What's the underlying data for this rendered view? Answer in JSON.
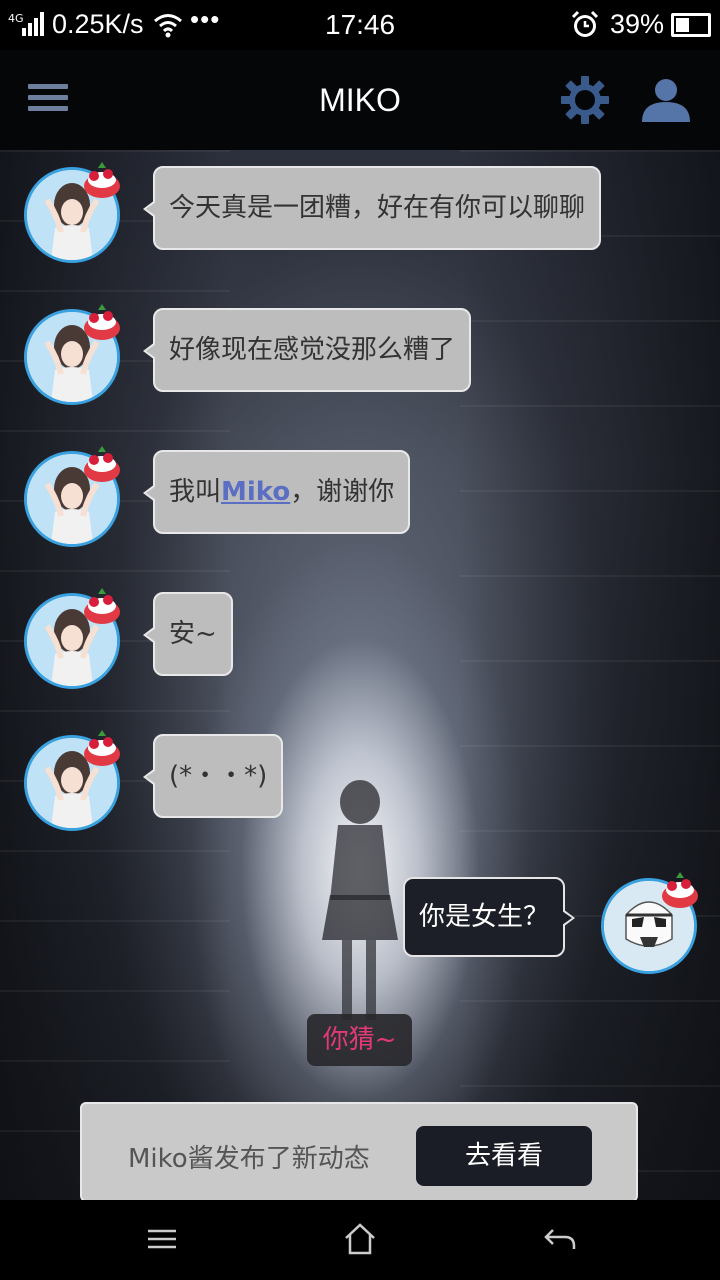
{
  "status_bar": {
    "network": "4G",
    "speed": "0.25K/s",
    "more": "•••",
    "time": "17:46",
    "battery_pct": "39%",
    "battery_level": 0.39
  },
  "header": {
    "title": "MIKO",
    "menu_icon": "menu-icon",
    "settings_icon": "gear-icon",
    "profile_icon": "profile-icon"
  },
  "messages": [
    {
      "from": "miko",
      "text": "今天真是一团糟，好在有你可以聊聊"
    },
    {
      "from": "miko",
      "text": "好像现在感觉没那么糟了"
    },
    {
      "from": "miko",
      "text_before": "我叫",
      "link": "Miko",
      "text_after": "，谢谢你"
    },
    {
      "from": "miko",
      "text": "安~"
    },
    {
      "from": "miko",
      "text": "(*・・*)"
    },
    {
      "from": "user",
      "text": "你是女生？"
    }
  ],
  "tip": "你猜~",
  "notice": {
    "text": "Miko酱发布了新动态",
    "button": "去看看"
  },
  "colors": {
    "tip_text": "#e23a75",
    "link": "#5a6fc4",
    "avatar_ring": "#3aa1e0"
  }
}
